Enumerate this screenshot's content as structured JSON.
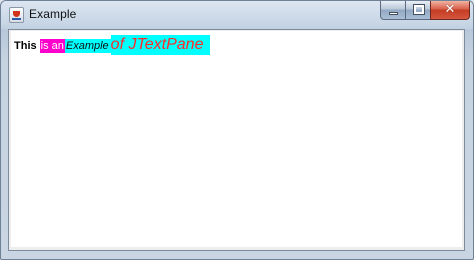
{
  "window": {
    "title": "Example",
    "icon": "java-icon",
    "controls": {
      "minimize_icon": "minimize-icon",
      "maximize_icon": "maximize-icon",
      "close_label": "✕"
    }
  },
  "text_pane": {
    "segments": [
      {
        "text": "This ",
        "style": "bold",
        "color": "#000000",
        "background": "#ffffff"
      },
      {
        "text": "is an",
        "style": "regular",
        "color": "#ffffff",
        "background": "#ff00cc"
      },
      {
        "text": "Example",
        "style": "italic",
        "color": "#111111",
        "background": "#00ffff"
      },
      {
        "text": "of JTextPane",
        "style": "italic-large",
        "color": "#ff2a2a",
        "background": "#00ffff"
      }
    ]
  }
}
